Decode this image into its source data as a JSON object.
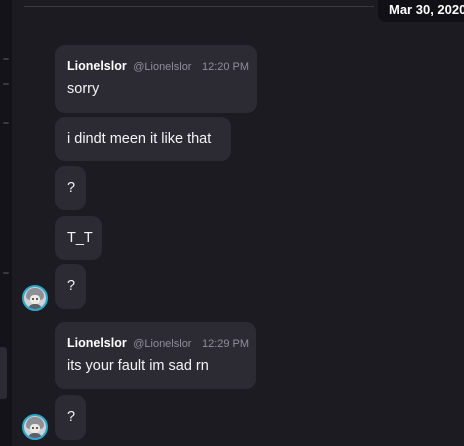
{
  "date_label": "Mar 30, 2020",
  "groups": [
    {
      "author": "Lionelslor",
      "handle": "@Lionelslor",
      "time": "12:20 PM",
      "messages": [
        "sorry",
        "i dindt meen it like that",
        "?",
        "T_T",
        "?"
      ]
    },
    {
      "author": "Lionelslor",
      "handle": "@Lionelslor",
      "time": "12:29 PM",
      "messages": [
        "its your fault im sad rn",
        "?"
      ]
    }
  ],
  "colors": {
    "background": "#1c1b22",
    "bubble": "#2c2b33",
    "date_pill": "#111016",
    "avatar_ring": "#2aa7c9"
  }
}
